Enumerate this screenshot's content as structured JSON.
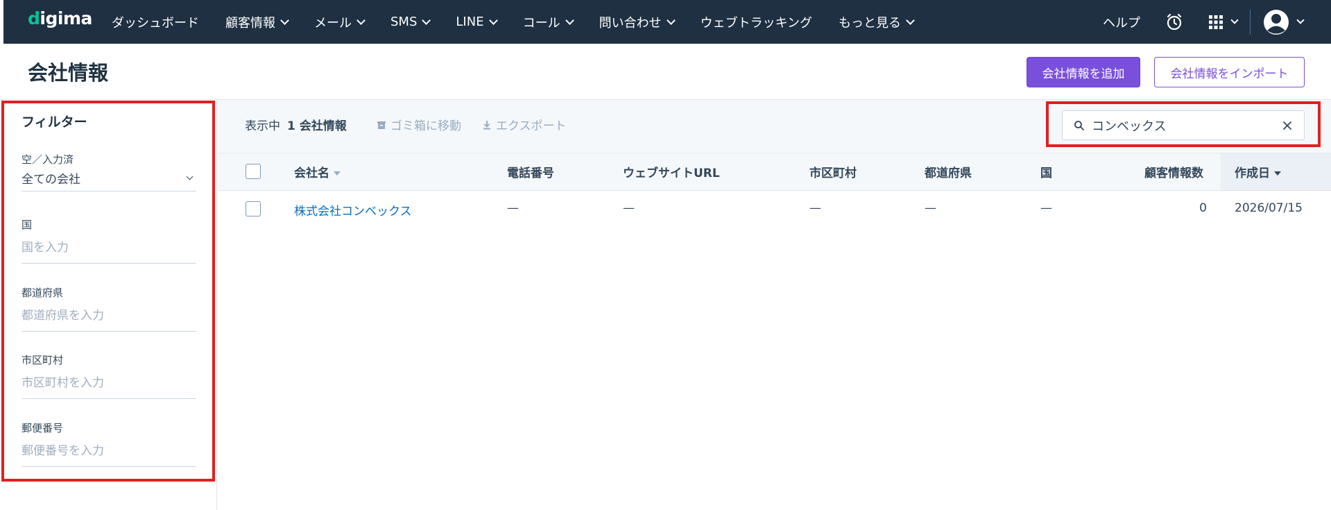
{
  "app": {
    "logo_text": "digima",
    "nav": [
      {
        "label": "ダッシュボード",
        "dropdown": false
      },
      {
        "label": "顧客情報",
        "dropdown": true
      },
      {
        "label": "メール",
        "dropdown": true
      },
      {
        "label": "SMS",
        "dropdown": true
      },
      {
        "label": "LINE",
        "dropdown": true
      },
      {
        "label": "コール",
        "dropdown": true
      },
      {
        "label": "問い合わせ",
        "dropdown": true
      },
      {
        "label": "ウェブトラッキング",
        "dropdown": false
      },
      {
        "label": "もっと見る",
        "dropdown": true
      }
    ],
    "help_label": "ヘルプ",
    "icons": [
      "alarm-clock-icon",
      "apps-grid-icon",
      "user-avatar-icon"
    ]
  },
  "page": {
    "title": "会社情報",
    "add_button": "会社情報を追加",
    "import_button": "会社情報をインポート"
  },
  "filters": {
    "title": "フィルター",
    "empty_filled": {
      "label": "空／入力済",
      "value": "全ての会社"
    },
    "country": {
      "label": "国",
      "placeholder": "国を入力"
    },
    "prefecture": {
      "label": "都道府県",
      "placeholder": "都道府県を入力"
    },
    "city": {
      "label": "市区町村",
      "placeholder": "市区町村を入力"
    },
    "postal": {
      "label": "郵便番号",
      "placeholder": "郵便番号を入力"
    }
  },
  "toolbar": {
    "showing_prefix": "表示中",
    "showing_count": "1 会社情報",
    "trash_label": "ゴミ箱に移動",
    "export_label": "エクスポート",
    "search_value": "コンベックス"
  },
  "table": {
    "columns": [
      "会社名",
      "電話番号",
      "ウェブサイトURL",
      "市区町村",
      "都道府県",
      "国",
      "顧客情報数",
      "作成日"
    ],
    "rows": [
      [
        "株式会社コンベックス",
        "—",
        "—",
        "—",
        "—",
        "—",
        "0",
        "2026/07/15"
      ]
    ]
  },
  "colors": {
    "nav_bg": "#1e3042",
    "accent": "#7a4fdc",
    "link": "#0a6ebd",
    "highlight": "#e02020"
  }
}
